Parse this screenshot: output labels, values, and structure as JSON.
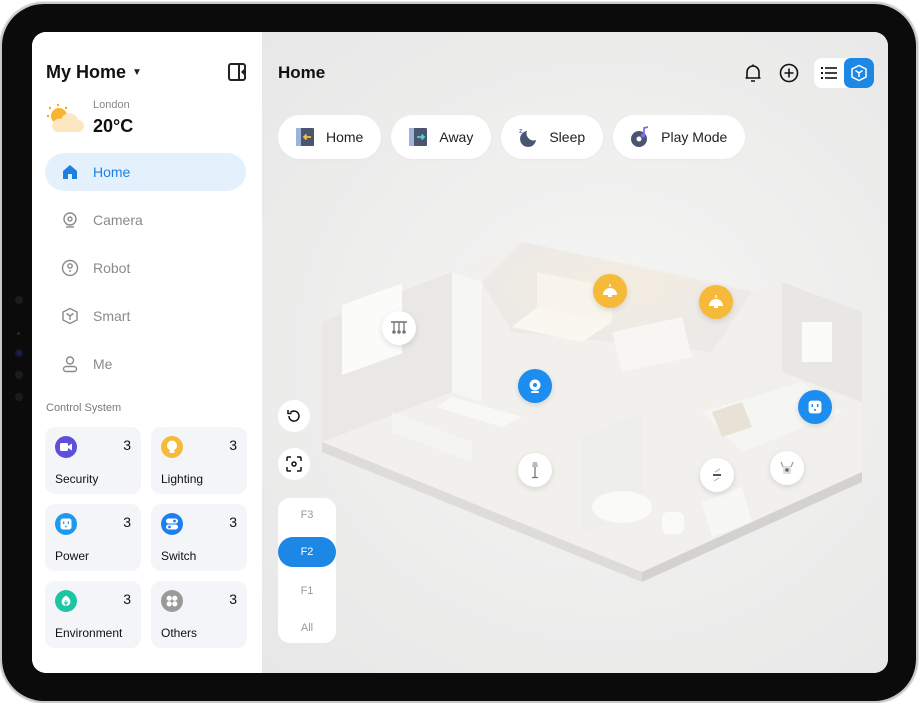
{
  "sidebar": {
    "home_selector": "My Home",
    "weather": {
      "city": "London",
      "temperature": "20°C",
      "icon": "partly-cloudy-icon"
    },
    "nav": [
      {
        "label": "Home",
        "icon": "home-icon",
        "active": true
      },
      {
        "label": "Camera",
        "icon": "camera-icon",
        "active": false
      },
      {
        "label": "Robot",
        "icon": "robot-icon",
        "active": false
      },
      {
        "label": "Smart",
        "icon": "cube-icon",
        "active": false
      },
      {
        "label": "Me",
        "icon": "user-icon",
        "active": false
      }
    ],
    "section_label": "Control System",
    "control_cards": [
      {
        "label": "Security",
        "count": "3",
        "icon": "video-camera-icon",
        "color": "#5b4fdb"
      },
      {
        "label": "Lighting",
        "count": "3",
        "icon": "bulb-icon",
        "color": "#f7b93a"
      },
      {
        "label": "Power",
        "count": "3",
        "icon": "outlet-icon",
        "color": "#1d9af0"
      },
      {
        "label": "Switch",
        "count": "3",
        "icon": "switch-icon",
        "color": "#1d7ef0"
      },
      {
        "label": "Environment",
        "count": "3",
        "icon": "leaf-icon",
        "color": "#1ec5a2"
      },
      {
        "label": "Others",
        "count": "3",
        "icon": "grid-icon",
        "color": "#9a9a9a"
      }
    ]
  },
  "main": {
    "title": "Home",
    "scenes": [
      {
        "label": "Home",
        "icon": "door-enter-icon"
      },
      {
        "label": "Away",
        "icon": "door-exit-icon"
      },
      {
        "label": "Sleep",
        "icon": "moon-icon"
      },
      {
        "label": "Play Mode",
        "icon": "music-disc-icon"
      }
    ],
    "floors": [
      "F3",
      "F2",
      "F1",
      "All"
    ],
    "active_floor": "F2",
    "devices": [
      {
        "name": "chandelier",
        "icon": "chandelier-icon",
        "state": "off"
      },
      {
        "name": "ceiling-lamp-bedroom",
        "icon": "pendant-lamp-icon",
        "state": "on"
      },
      {
        "name": "ceiling-lamp-dining",
        "icon": "pendant-lamp-icon",
        "state": "on"
      },
      {
        "name": "camera",
        "icon": "camera-icon",
        "state": "on"
      },
      {
        "name": "smart-plug",
        "icon": "outlet-icon",
        "state": "on"
      },
      {
        "name": "floor-lamp",
        "icon": "floor-lamp-icon",
        "state": "off"
      },
      {
        "name": "switch",
        "icon": "switch-icon",
        "state": "off"
      },
      {
        "name": "router",
        "icon": "router-icon",
        "state": "off"
      }
    ]
  },
  "colors": {
    "accent": "#1d87e5",
    "active_nav_bg": "#e4f1fc",
    "lamp_on": "#f7b93a"
  }
}
